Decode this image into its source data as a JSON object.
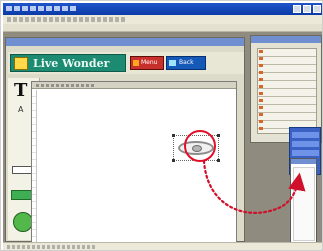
{
  "app": {
    "logo_text": "Live Wonder",
    "buttons": {
      "red_label": "Menu",
      "blue_label": "Back"
    },
    "left_panel": {
      "big_letter": "T",
      "small_letter": "A"
    }
  },
  "colors": {
    "titlebar": "#1f55c9",
    "logo_bg": "#1d8b72",
    "red_button": "#c8312b",
    "blue_button": "#1458b8",
    "highlight": "#e0102a",
    "green_shape": "#52b84a"
  },
  "icons": {
    "logo": "logo-icon",
    "red_button": "menu-icon",
    "blue_button": "speaker-icon",
    "canvas_object": "disc-icon"
  }
}
